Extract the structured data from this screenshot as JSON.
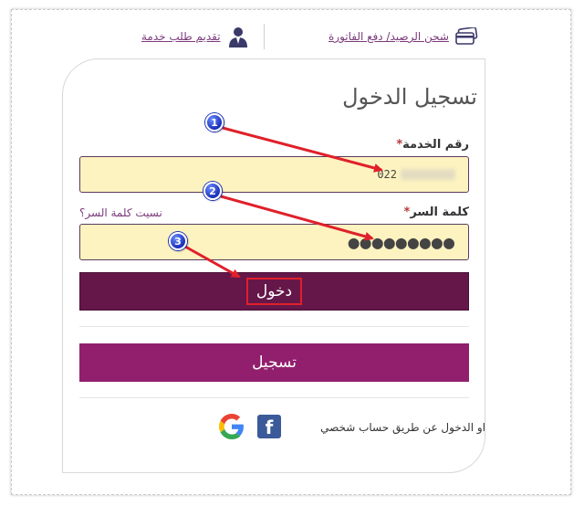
{
  "header": {
    "pay_link": "شحن الرصيد/ دفع الفاتورة",
    "request_link": "تقديم طلب خدمة"
  },
  "login": {
    "title": "تسجيل الدخول",
    "service_label": "رقم الخدمة",
    "required_mark": "*",
    "service_value": "022",
    "password_label": "كلمة السر",
    "password_value": "●●●●●●●●●",
    "forgot_link": "نسيت كلمة السر؟",
    "login_button": "دخول",
    "register_button": "تسجيل",
    "social_text": "او الدخول عن طريق حساب شخصي"
  },
  "annotations": {
    "badge_1": "1",
    "badge_2": "2",
    "badge_3": "3"
  },
  "colors": {
    "login_button": "#651749",
    "register_button": "#911f6e",
    "input_bg": "#fdf3c0",
    "link": "#7a3a7a",
    "arrow": "#e0202a",
    "facebook": "#3b5a99"
  },
  "icons": {
    "pay": "credit-card-icon",
    "request": "user-tie-icon",
    "facebook": "facebook-icon",
    "google": "google-icon"
  }
}
